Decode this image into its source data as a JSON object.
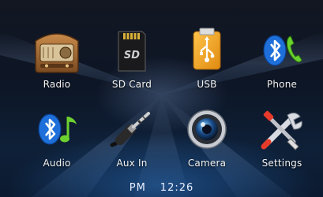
{
  "apps": [
    {
      "label": "Radio",
      "icon": "radio-icon"
    },
    {
      "label": "SD Card",
      "icon": "sd-card-icon"
    },
    {
      "label": "USB",
      "icon": "usb-drive-icon"
    },
    {
      "label": "Phone",
      "icon": "bluetooth-phone-icon"
    },
    {
      "label": "Audio",
      "icon": "bluetooth-audio-icon"
    },
    {
      "label": "Aux In",
      "icon": "aux-cable-icon"
    },
    {
      "label": "Camera",
      "icon": "camera-lens-icon"
    },
    {
      "label": "Settings",
      "icon": "tools-icon"
    }
  ],
  "status_bar": {
    "ampm": "PM",
    "time": "12:26"
  },
  "colors": {
    "bluetooth": "#1e6fd9",
    "accent_green": "#6cd12f",
    "usb_orange": "#f0a020"
  }
}
